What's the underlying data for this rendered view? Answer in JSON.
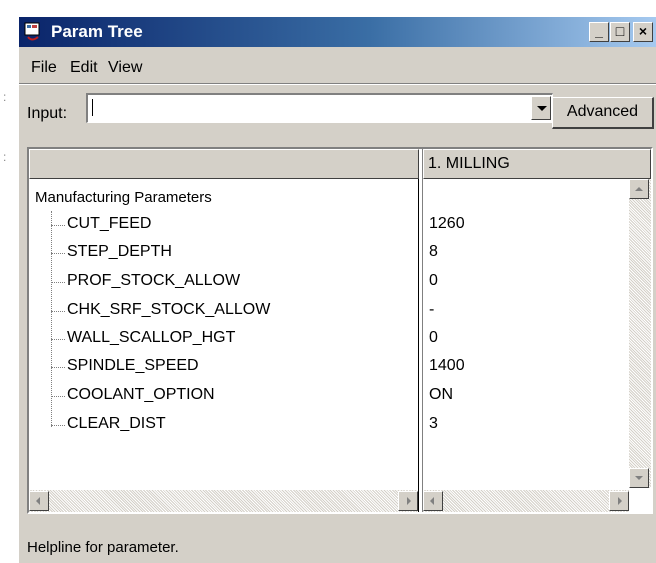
{
  "window": {
    "title": "Param Tree",
    "controls": {
      "minimize": "_",
      "maximize": "□",
      "close": "×"
    }
  },
  "menu": [
    "File",
    "Edit",
    "View"
  ],
  "input": {
    "label": "Input:",
    "value": ""
  },
  "advanced_button": "Advanced",
  "grid": {
    "left_header": "",
    "right_header": "1. MILLING",
    "root": "Manufacturing Parameters",
    "rows": [
      {
        "name": "CUT_FEED",
        "value": "1260"
      },
      {
        "name": "STEP_DEPTH",
        "value": "8"
      },
      {
        "name": "PROF_STOCK_ALLOW",
        "value": "0"
      },
      {
        "name": "CHK_SRF_STOCK_ALLOW",
        "value": "-"
      },
      {
        "name": "WALL_SCALLOP_HGT",
        "value": "0"
      },
      {
        "name": "SPINDLE_SPEED",
        "value": "1400"
      },
      {
        "name": "COOLANT_OPTION",
        "value": "ON"
      },
      {
        "name": "CLEAR_DIST",
        "value": "3"
      }
    ]
  },
  "status": {
    "helpline": "Helpline for parameter."
  }
}
